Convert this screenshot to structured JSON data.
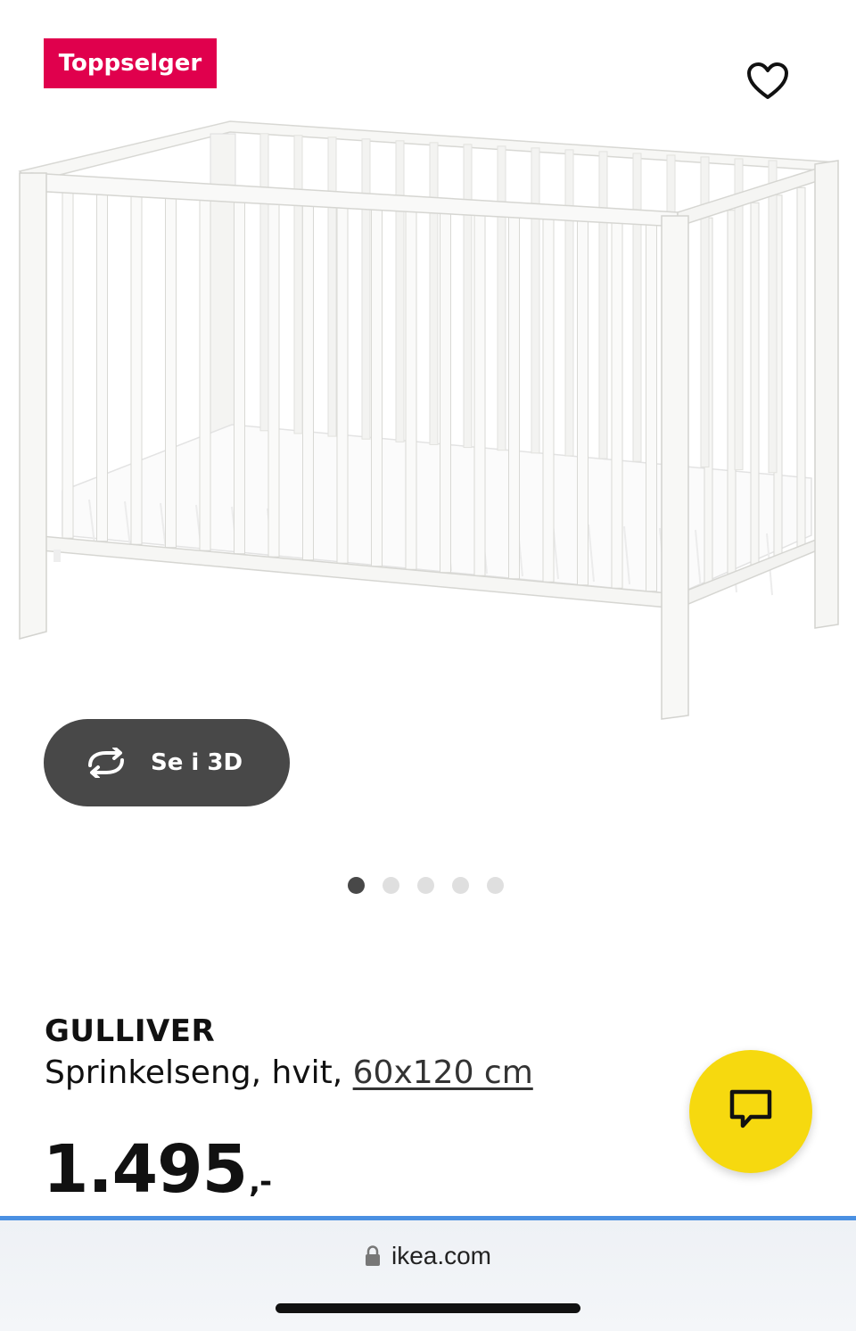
{
  "badge": {
    "label": "Toppselger",
    "color": "#e0004d"
  },
  "favorite": {
    "icon": "heart-icon"
  },
  "gallery": {
    "image_alt": "GULLIVER crib",
    "view_3d_label": "Se i 3D",
    "view_3d_icon": "rotate-3d-icon",
    "dots_total": 5,
    "dots_active_index": 0
  },
  "product": {
    "name": "GULLIVER",
    "description": "Sprinkelseng, hvit,",
    "size": "60x120 cm",
    "price": "1.495",
    "price_suffix": ",-"
  },
  "chat": {
    "icon": "chat-icon",
    "color": "#f6d90f"
  },
  "browser": {
    "url": "ikea.com",
    "lock_icon": "lock-icon",
    "progress_color": "#4a90e2"
  }
}
